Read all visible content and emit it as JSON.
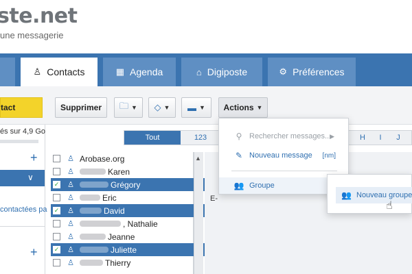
{
  "brand": {
    "logo": "ste.net",
    "tagline": "une messagerie"
  },
  "tabs": [
    {
      "label": "Contacts",
      "icon": "person-icon",
      "active": true
    },
    {
      "label": "Agenda",
      "icon": "calendar-icon",
      "active": false
    },
    {
      "label": "Digiposte",
      "icon": "digiposte-icon",
      "active": false
    },
    {
      "label": "Préférences",
      "icon": "gear-icon",
      "active": false
    }
  ],
  "toolbar": {
    "new_contact_label": "tact",
    "delete_label": "Supprimer",
    "actions_label": "Actions"
  },
  "sidebar": {
    "quota": "és sur 4,9 Go",
    "link": "contactées pa"
  },
  "filter": {
    "all": "Tout",
    "numbers": "123",
    "letters": [
      "H",
      "I",
      "J"
    ]
  },
  "contacts": [
    {
      "name": "Arobase.org",
      "selected": false
    },
    {
      "name": "Karen",
      "selected": false
    },
    {
      "name": "Grégory",
      "selected": true
    },
    {
      "name": "Eric",
      "selected": false
    },
    {
      "name": "David",
      "selected": true
    },
    {
      "name": ", Nathalie",
      "selected": false
    },
    {
      "name": "Jeanne",
      "selected": false
    },
    {
      "name": "Juliette",
      "selected": true
    },
    {
      "name": "Thierry",
      "selected": false
    }
  ],
  "detail": {
    "label": "E-"
  },
  "actions_menu": {
    "search": "Rechercher messages...",
    "new_message": "Nouveau message",
    "new_message_shortcut": "[nm]",
    "group": "Groupe"
  },
  "group_submenu": {
    "new_group": "Nouveau groupe"
  },
  "colors": {
    "accent": "#3b74b0",
    "tab_inactive": "#5f8fc3",
    "new_button": "#f3d32a"
  }
}
